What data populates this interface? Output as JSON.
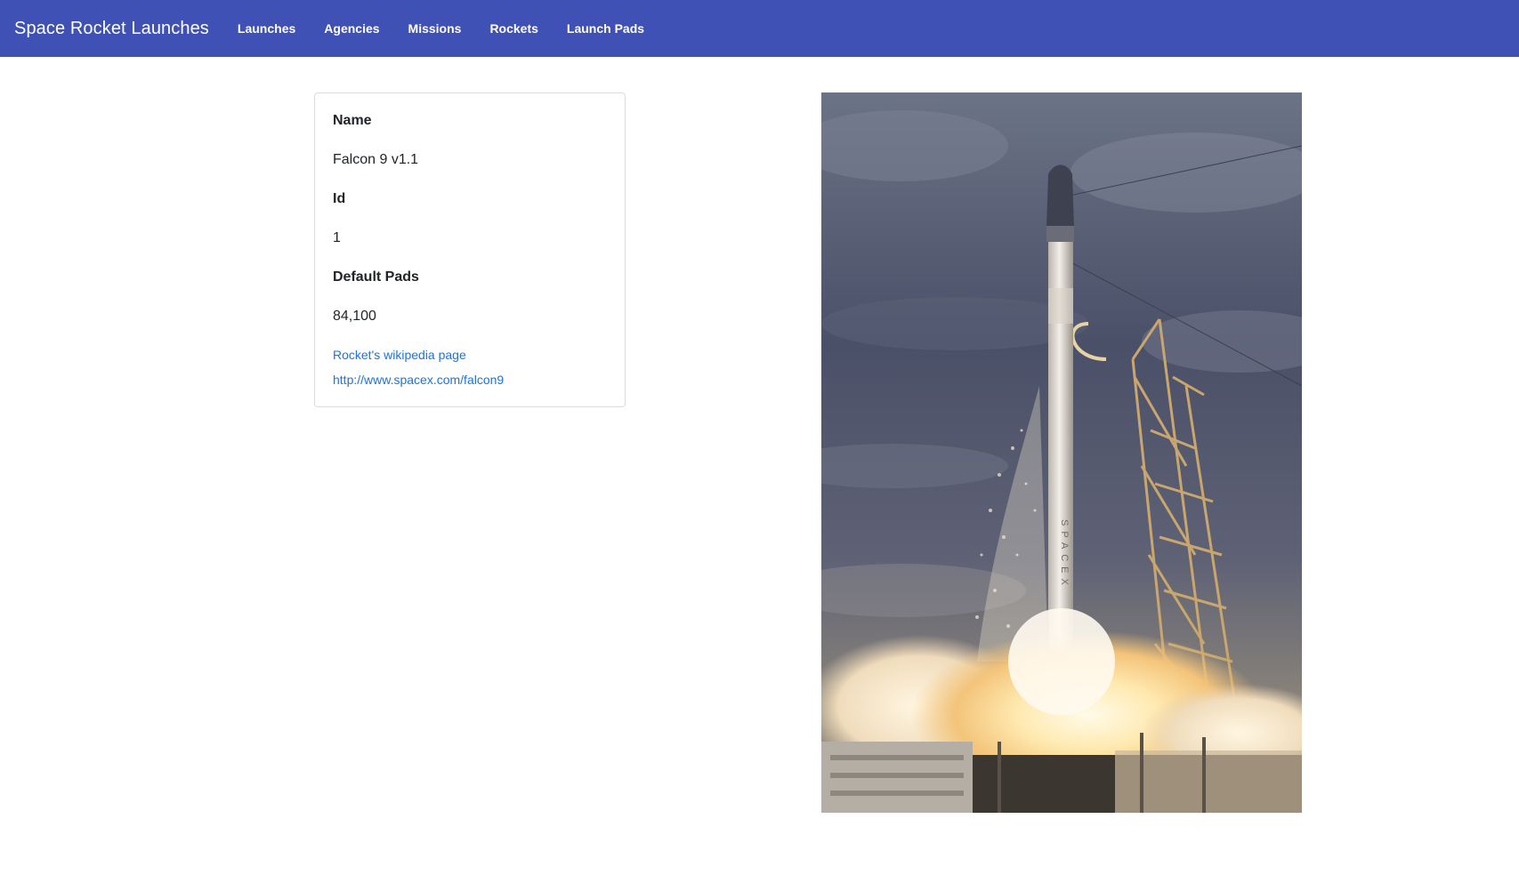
{
  "navbar": {
    "brand": "Space Rocket Launches",
    "links": [
      "Launches",
      "Agencies",
      "Missions",
      "Rockets",
      "Launch Pads"
    ],
    "color": "#3f51b5"
  },
  "rocket": {
    "name_label": "Name",
    "name": "Falcon 9 v1.1",
    "id_label": "Id",
    "id": "1",
    "pads_label": "Default Pads",
    "pads": "84,100",
    "wiki_link": "Rocket's wikipedia page",
    "info_url": "http://www.spacex.com/falcon9",
    "link_color": "#1a73e8"
  },
  "image": {
    "body_lettering": "SPACEX"
  }
}
